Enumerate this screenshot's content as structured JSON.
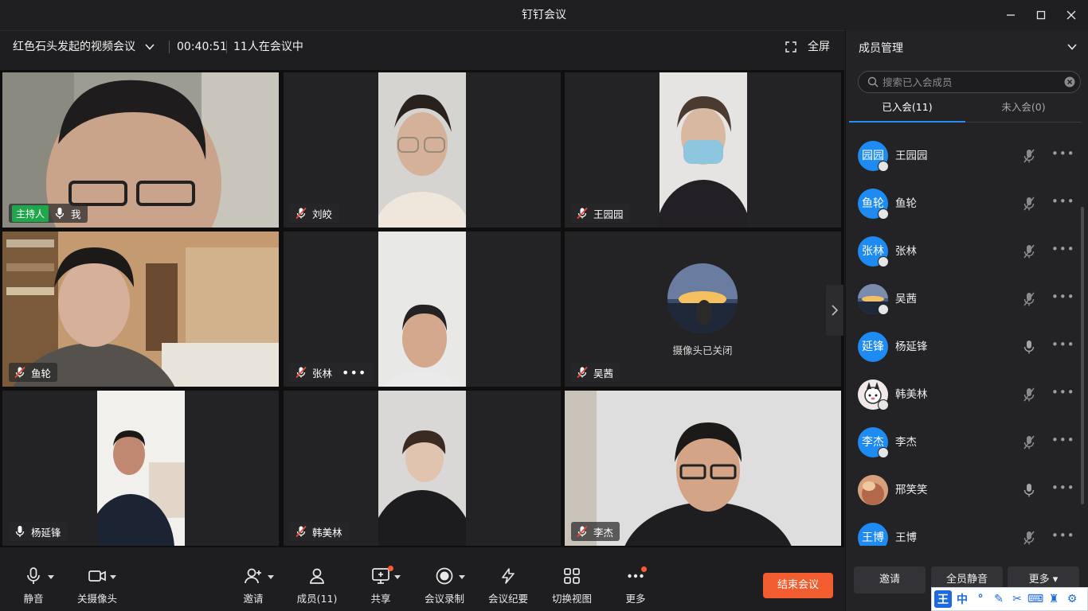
{
  "window": {
    "title": "钉钉会议"
  },
  "infobar": {
    "meeting_title": "红色石头发起的视频会议",
    "timer": "00:40:51",
    "count": "11人在会议中",
    "fullscreen_label": "全屏"
  },
  "tiles": [
    {
      "name": "我",
      "host_label": "主持人"
    },
    {
      "name": "刘皎"
    },
    {
      "name": "王园园"
    },
    {
      "name": "鱼轮"
    },
    {
      "name": "张林",
      "more": "•••"
    },
    {
      "name": "吴茜",
      "camera_off_text": "摄像头已关闭"
    },
    {
      "name": "杨延锋"
    },
    {
      "name": "韩美林"
    },
    {
      "name": "李杰"
    }
  ],
  "toolbar": {
    "items": [
      {
        "label": "静音"
      },
      {
        "label": "关摄像头"
      },
      {
        "label": "邀请"
      },
      {
        "label": "成员(11)"
      },
      {
        "label": "共享"
      },
      {
        "label": "会议录制"
      },
      {
        "label": "会议纪要"
      },
      {
        "label": "切换视图"
      },
      {
        "label": "更多"
      }
    ],
    "end_label": "结束会议"
  },
  "panel": {
    "title": "成员管理",
    "search_placeholder": "搜索已入会成员",
    "tab_joined": "已入会(11)",
    "tab_not_joined": "未入会(0)",
    "members": [
      {
        "avatar_text": "园园",
        "name": "王园园",
        "mic": "muted"
      },
      {
        "avatar_text": "鱼轮",
        "name": "鱼轮",
        "mic": "muted"
      },
      {
        "avatar_text": "张林",
        "name": "张林",
        "mic": "muted"
      },
      {
        "avatar_text": "",
        "name": "吴茜",
        "mic": "muted"
      },
      {
        "avatar_text": "延锋",
        "name": "杨延锋",
        "mic": "on"
      },
      {
        "avatar_text": "",
        "name": "韩美林",
        "mic": "muted"
      },
      {
        "avatar_text": "李杰",
        "name": "李杰",
        "mic": "muted"
      },
      {
        "avatar_text": "",
        "name": "邢笑笑",
        "mic": "on"
      },
      {
        "avatar_text": "王博",
        "name": "王博",
        "mic": "muted"
      }
    ],
    "more_dots": "•••",
    "buttons": {
      "invite": "邀请",
      "mute_all": "全员静音",
      "more": "更多 ▾"
    }
  },
  "ime": {
    "logo": "王",
    "mode": "中"
  },
  "colors": {
    "accent": "#2b8cf2",
    "end_button": "#f25d2f",
    "host_tag": "#1ea84b",
    "muted_red": "#e8493a"
  }
}
